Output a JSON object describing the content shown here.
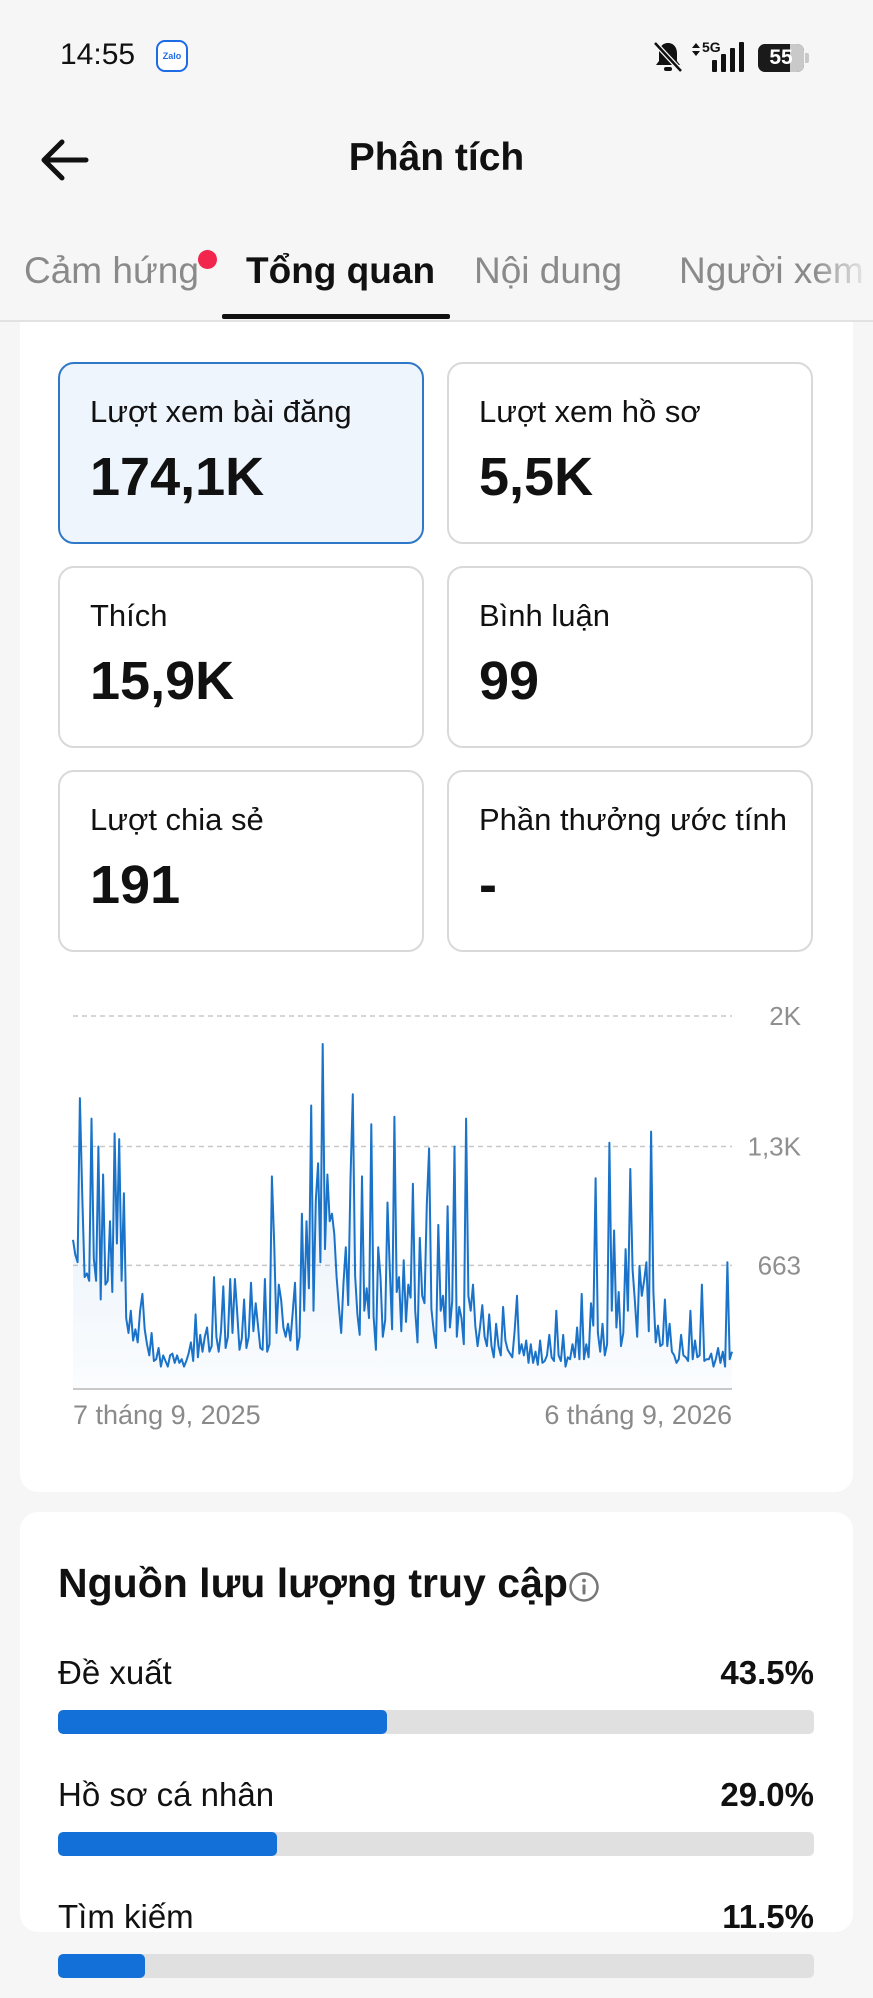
{
  "status_bar": {
    "time": "14:55",
    "app_icon": "zalo-icon",
    "app_icon_text": "Zalo",
    "network": "5G",
    "battery": "55"
  },
  "header": {
    "title": "Phân tích",
    "back_icon": "back-arrow-icon"
  },
  "tabs": [
    {
      "label": "Cảm hứng",
      "active": false,
      "has_dot": true
    },
    {
      "label": "Tổng quan",
      "active": true,
      "has_dot": false
    },
    {
      "label": "Nội dung",
      "active": false,
      "has_dot": false
    },
    {
      "label": "Người xem",
      "active": false,
      "has_dot": false
    }
  ],
  "metrics": [
    {
      "label": "Lượt xem bài đăng",
      "value": "174,1K",
      "selected": true
    },
    {
      "label": "Lượt xem hồ sơ",
      "value": "5,5K",
      "selected": false
    },
    {
      "label": "Thích",
      "value": "15,9K",
      "selected": false
    },
    {
      "label": "Bình luận",
      "value": "99",
      "selected": false
    },
    {
      "label": "Lượt chia sẻ",
      "value": "191",
      "selected": false
    },
    {
      "label": "Phần thưởng ước tính",
      "value": "-",
      "selected": false
    }
  ],
  "chart_data": {
    "type": "area",
    "series_color": "#1a73c9",
    "y_ticks": [
      "2K",
      "1,3K",
      "663"
    ],
    "y_tick_values": [
      2000,
      1300,
      663
    ],
    "ylim": [
      0,
      2000
    ],
    "x_labels": [
      "7 tháng 9, 2025",
      "6 tháng 9, 2026"
    ],
    "grid": "dashed horizontal",
    "values": [
      800,
      720,
      680,
      1560,
      1050,
      600,
      620,
      580,
      1450,
      700,
      580,
      1300,
      480,
      1150,
      560,
      580,
      900,
      520,
      1370,
      780,
      1340,
      580,
      1050,
      380,
      300,
      420,
      260,
      320,
      250,
      420,
      510,
      320,
      240,
      180,
      300,
      150,
      160,
      220,
      120,
      180,
      150,
      120,
      180,
      190,
      140,
      180,
      140,
      160,
      120,
      150,
      190,
      250,
      150,
      400,
      170,
      290,
      200,
      280,
      330,
      200,
      230,
      600,
      280,
      200,
      310,
      550,
      220,
      280,
      590,
      300,
      590,
      410,
      210,
      270,
      480,
      220,
      280,
      570,
      310,
      460,
      340,
      220,
      210,
      590,
      200,
      240,
      1140,
      780,
      300,
      560,
      480,
      330,
      280,
      350,
      260,
      410,
      570,
      210,
      280,
      940,
      420,
      900,
      540,
      1520,
      420,
      1010,
      1210,
      680,
      1850,
      750,
      1150,
      900,
      940,
      830,
      600,
      440,
      300,
      570,
      760,
      450,
      1130,
      1580,
      610,
      400,
      290,
      1140,
      420,
      540,
      380,
      1420,
      390,
      210,
      760,
      600,
      280,
      370,
      1000,
      640,
      320,
      1460,
      520,
      600,
      310,
      690,
      360,
      560,
      490,
      1100,
      420,
      250,
      810,
      500,
      460,
      990,
      1290,
      430,
      310,
      220,
      880,
      420,
      500,
      310,
      980,
      330,
      470,
      1300,
      280,
      440,
      380,
      240,
      1450,
      500,
      420,
      560,
      340,
      230,
      330,
      450,
      280,
      230,
      400,
      230,
      170,
      350,
      230,
      180,
      440,
      260,
      210,
      190,
      170,
      310,
      500,
      190,
      240,
      180,
      260,
      140,
      240,
      140,
      200,
      130,
      260,
      140,
      150,
      180,
      290,
      170,
      150,
      420,
      180,
      150,
      290,
      120,
      170,
      160,
      240,
      170,
      330,
      160,
      510,
      160,
      240,
      170,
      460,
      340,
      1130,
      300,
      200,
      350,
      180,
      240,
      1320,
      420,
      850,
      330,
      520,
      230,
      300,
      750,
      420,
      1180,
      640,
      470,
      280,
      660,
      500,
      580,
      680,
      310,
      1380,
      520,
      250,
      340,
      230,
      240,
      480,
      230,
      350,
      200,
      180,
      140,
      160,
      290,
      180,
      170,
      150,
      420,
      160,
      260,
      170,
      180,
      560,
      150,
      160,
      160,
      190,
      120,
      160,
      220,
      140,
      200,
      120,
      680,
      160,
      200
    ]
  },
  "traffic": {
    "title": "Nguồn lưu lượng truy cập",
    "info_icon": "info-icon",
    "sources": [
      {
        "name": "Đề xuất",
        "percent_label": "43.5%",
        "percent": 43.5
      },
      {
        "name": "Hồ sơ cá nhân",
        "percent_label": "29.0%",
        "percent": 29.0
      },
      {
        "name": "Tìm kiếm",
        "percent_label": "11.5%",
        "percent": 11.5
      }
    ]
  }
}
